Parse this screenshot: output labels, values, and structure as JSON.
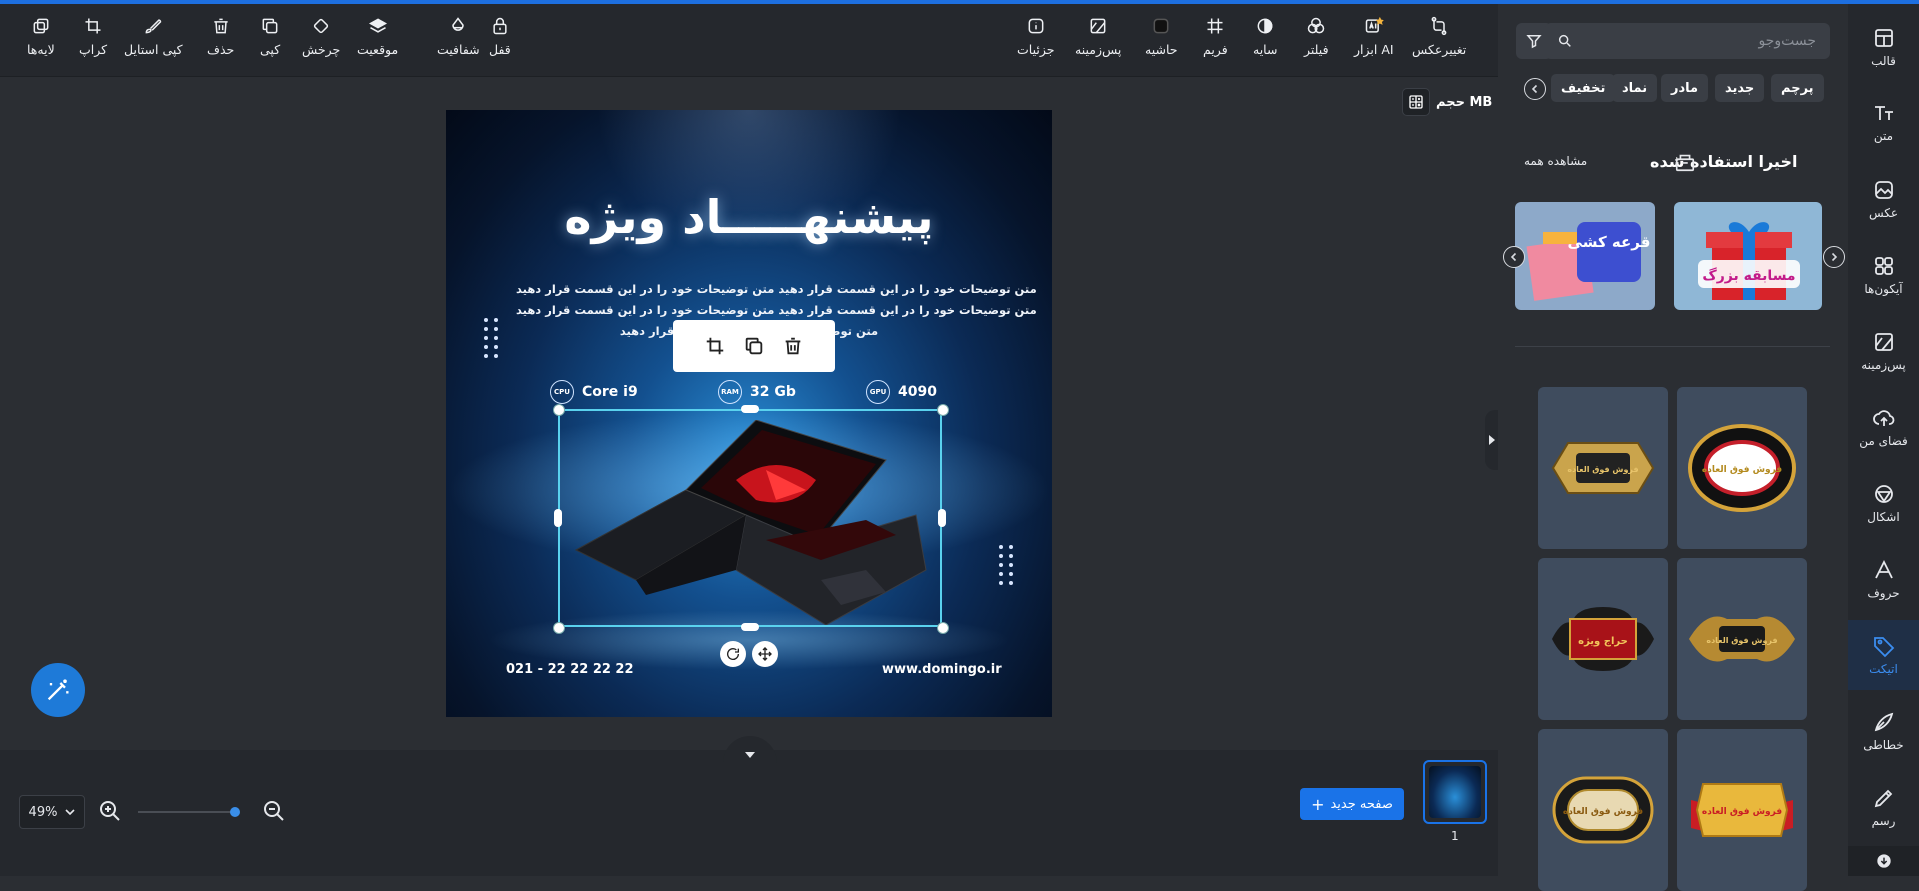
{
  "toolbar": {
    "right_tools": [
      {
        "label": "تغییرعکس",
        "icon": "swap-image-icon"
      },
      {
        "label": "ابزار AI",
        "icon": "ai-tools-icon"
      },
      {
        "label": "فیلتر",
        "icon": "filter-circles-icon"
      },
      {
        "label": "سایه",
        "icon": "shadow-icon"
      },
      {
        "label": "فریم",
        "icon": "frame-icon"
      },
      {
        "label": "حاشیه",
        "icon": "border-icon"
      },
      {
        "label": "پس‌زمینه",
        "icon": "background-icon"
      },
      {
        "label": "جزئیات",
        "icon": "info-icon"
      }
    ],
    "left_tools": [
      {
        "label": "قفل",
        "icon": "lock-icon"
      },
      {
        "label": "شفافیت",
        "icon": "opacity-icon"
      },
      {
        "label": "موقعیت",
        "icon": "layers-position-icon"
      },
      {
        "label": "چرخش",
        "icon": "rotate-icon"
      },
      {
        "label": "کپی",
        "icon": "copy-icon"
      },
      {
        "label": "حذف",
        "icon": "trash-icon"
      },
      {
        "label": "کپی استایل",
        "icon": "copy-style-icon"
      },
      {
        "label": "کراپ",
        "icon": "crop-icon"
      },
      {
        "label": "لایه‌ها",
        "icon": "layers-icon"
      }
    ]
  },
  "canvas": {
    "size_label": "حجم MB",
    "design": {
      "title": "پیشنهـــــاد ویژه",
      "desc_lines": [
        "متن توضیحات خود را در این قسمت قرار دهید متن توضیحات خود را در این قسمت قرار دهید",
        "متن توضیحات خود را در این قسمت قرار دهید متن توضیحات خود را در این قسمت قرار دهید",
        "متن توضیحات خود را در این قسمت قرار دهید"
      ],
      "specs": [
        {
          "chip": "CPU",
          "value": "Core i9"
        },
        {
          "chip": "RAM",
          "value": "32 Gb"
        },
        {
          "chip": "GPU",
          "value": "4090"
        }
      ],
      "phone": "021 - 22 22 22 22",
      "website": "www.domingo.ir"
    }
  },
  "bottom": {
    "zoom": "49%",
    "new_page": "صفحه جدید",
    "page_number": "1"
  },
  "panel": {
    "search_placeholder": "جست‌وجو",
    "tags": [
      "پرچم",
      "جدید",
      "مادر",
      "نماد",
      "تخفیف"
    ],
    "recent_title": "اخیرا استفاده شده",
    "see_all": "مشاهده همه",
    "recent_cards": [
      {
        "text": "مسابقه بزرگ",
        "color": "#3aa3e0"
      },
      {
        "text": "قرعه کشی",
        "color": "#5b6fd6"
      }
    ],
    "stickers": [
      {
        "text": "فروش فوق العاده",
        "style": "black-gold"
      },
      {
        "text": "فروش فوق العاده",
        "style": "gold"
      },
      {
        "text": "فروش فوق العاده",
        "style": "gold-ornate"
      },
      {
        "text": "حراج ویژه",
        "style": "red"
      },
      {
        "text": "فروش فوق العاده",
        "style": "red-ribbon"
      },
      {
        "text": "فروش فوق العاده",
        "style": "black-gold-round"
      }
    ]
  },
  "right_nav": [
    {
      "label": "قالب",
      "icon": "template-icon"
    },
    {
      "label": "متن",
      "icon": "text-icon"
    },
    {
      "label": "عکس",
      "icon": "image-icon"
    },
    {
      "label": "آیکون‌ها",
      "icon": "icons-grid-icon"
    },
    {
      "label": "پس‌زمینه",
      "icon": "background-icon"
    },
    {
      "label": "فضای من",
      "icon": "upload-cloud-icon"
    },
    {
      "label": "اشکال",
      "icon": "shapes-icon"
    },
    {
      "label": "حروف",
      "icon": "letters-icon"
    },
    {
      "label": "اتیکت",
      "icon": "tag-icon"
    },
    {
      "label": "خطاطی",
      "icon": "calligraphy-icon"
    },
    {
      "label": "رسم",
      "icon": "draw-icon"
    }
  ]
}
